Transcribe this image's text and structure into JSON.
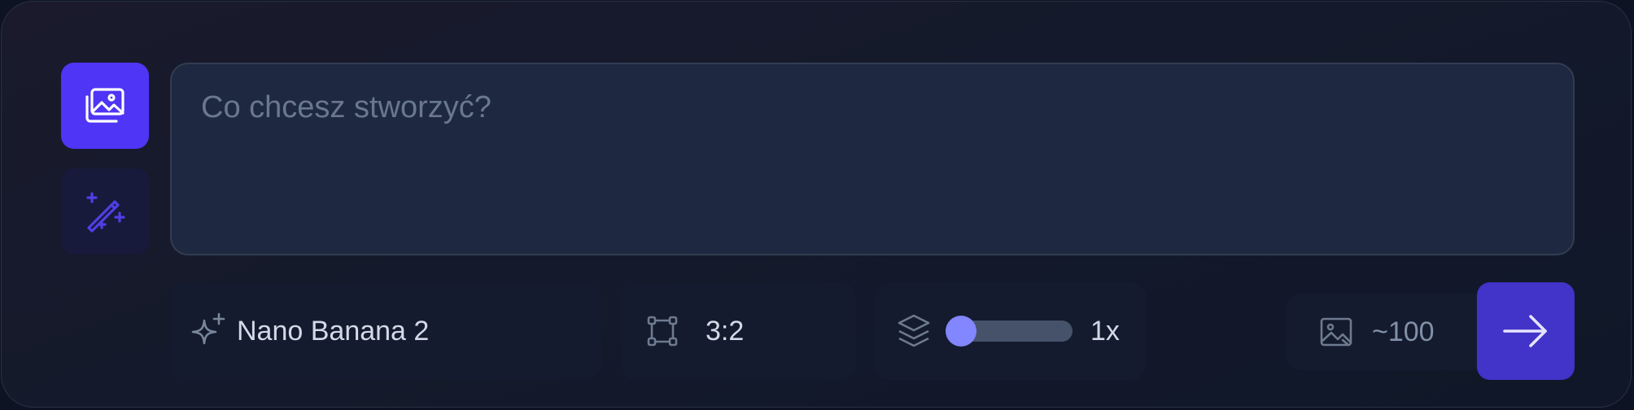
{
  "prompt": {
    "placeholder": "Co chcesz stworzyć?",
    "value": ""
  },
  "modes": [
    {
      "name": "image-mode",
      "active": true
    },
    {
      "name": "magic-mode",
      "active": false
    }
  ],
  "model": {
    "label": "Nano Banana 2"
  },
  "aspect_ratio": {
    "label": "3:2"
  },
  "quantity": {
    "label": "1x",
    "value": 1
  },
  "credits": {
    "label": "~100"
  },
  "colors": {
    "accent": "#4f35f5",
    "submit": "#4233c9",
    "slider_thumb": "#8286ff"
  },
  "icons": {
    "image_mode": "images-icon",
    "magic_mode": "magic-wand-icon",
    "model": "sparkles-icon",
    "ratio": "crop-frame-icon",
    "quantity": "layers-icon",
    "credits": "image-icon",
    "submit": "arrow-right-icon"
  }
}
